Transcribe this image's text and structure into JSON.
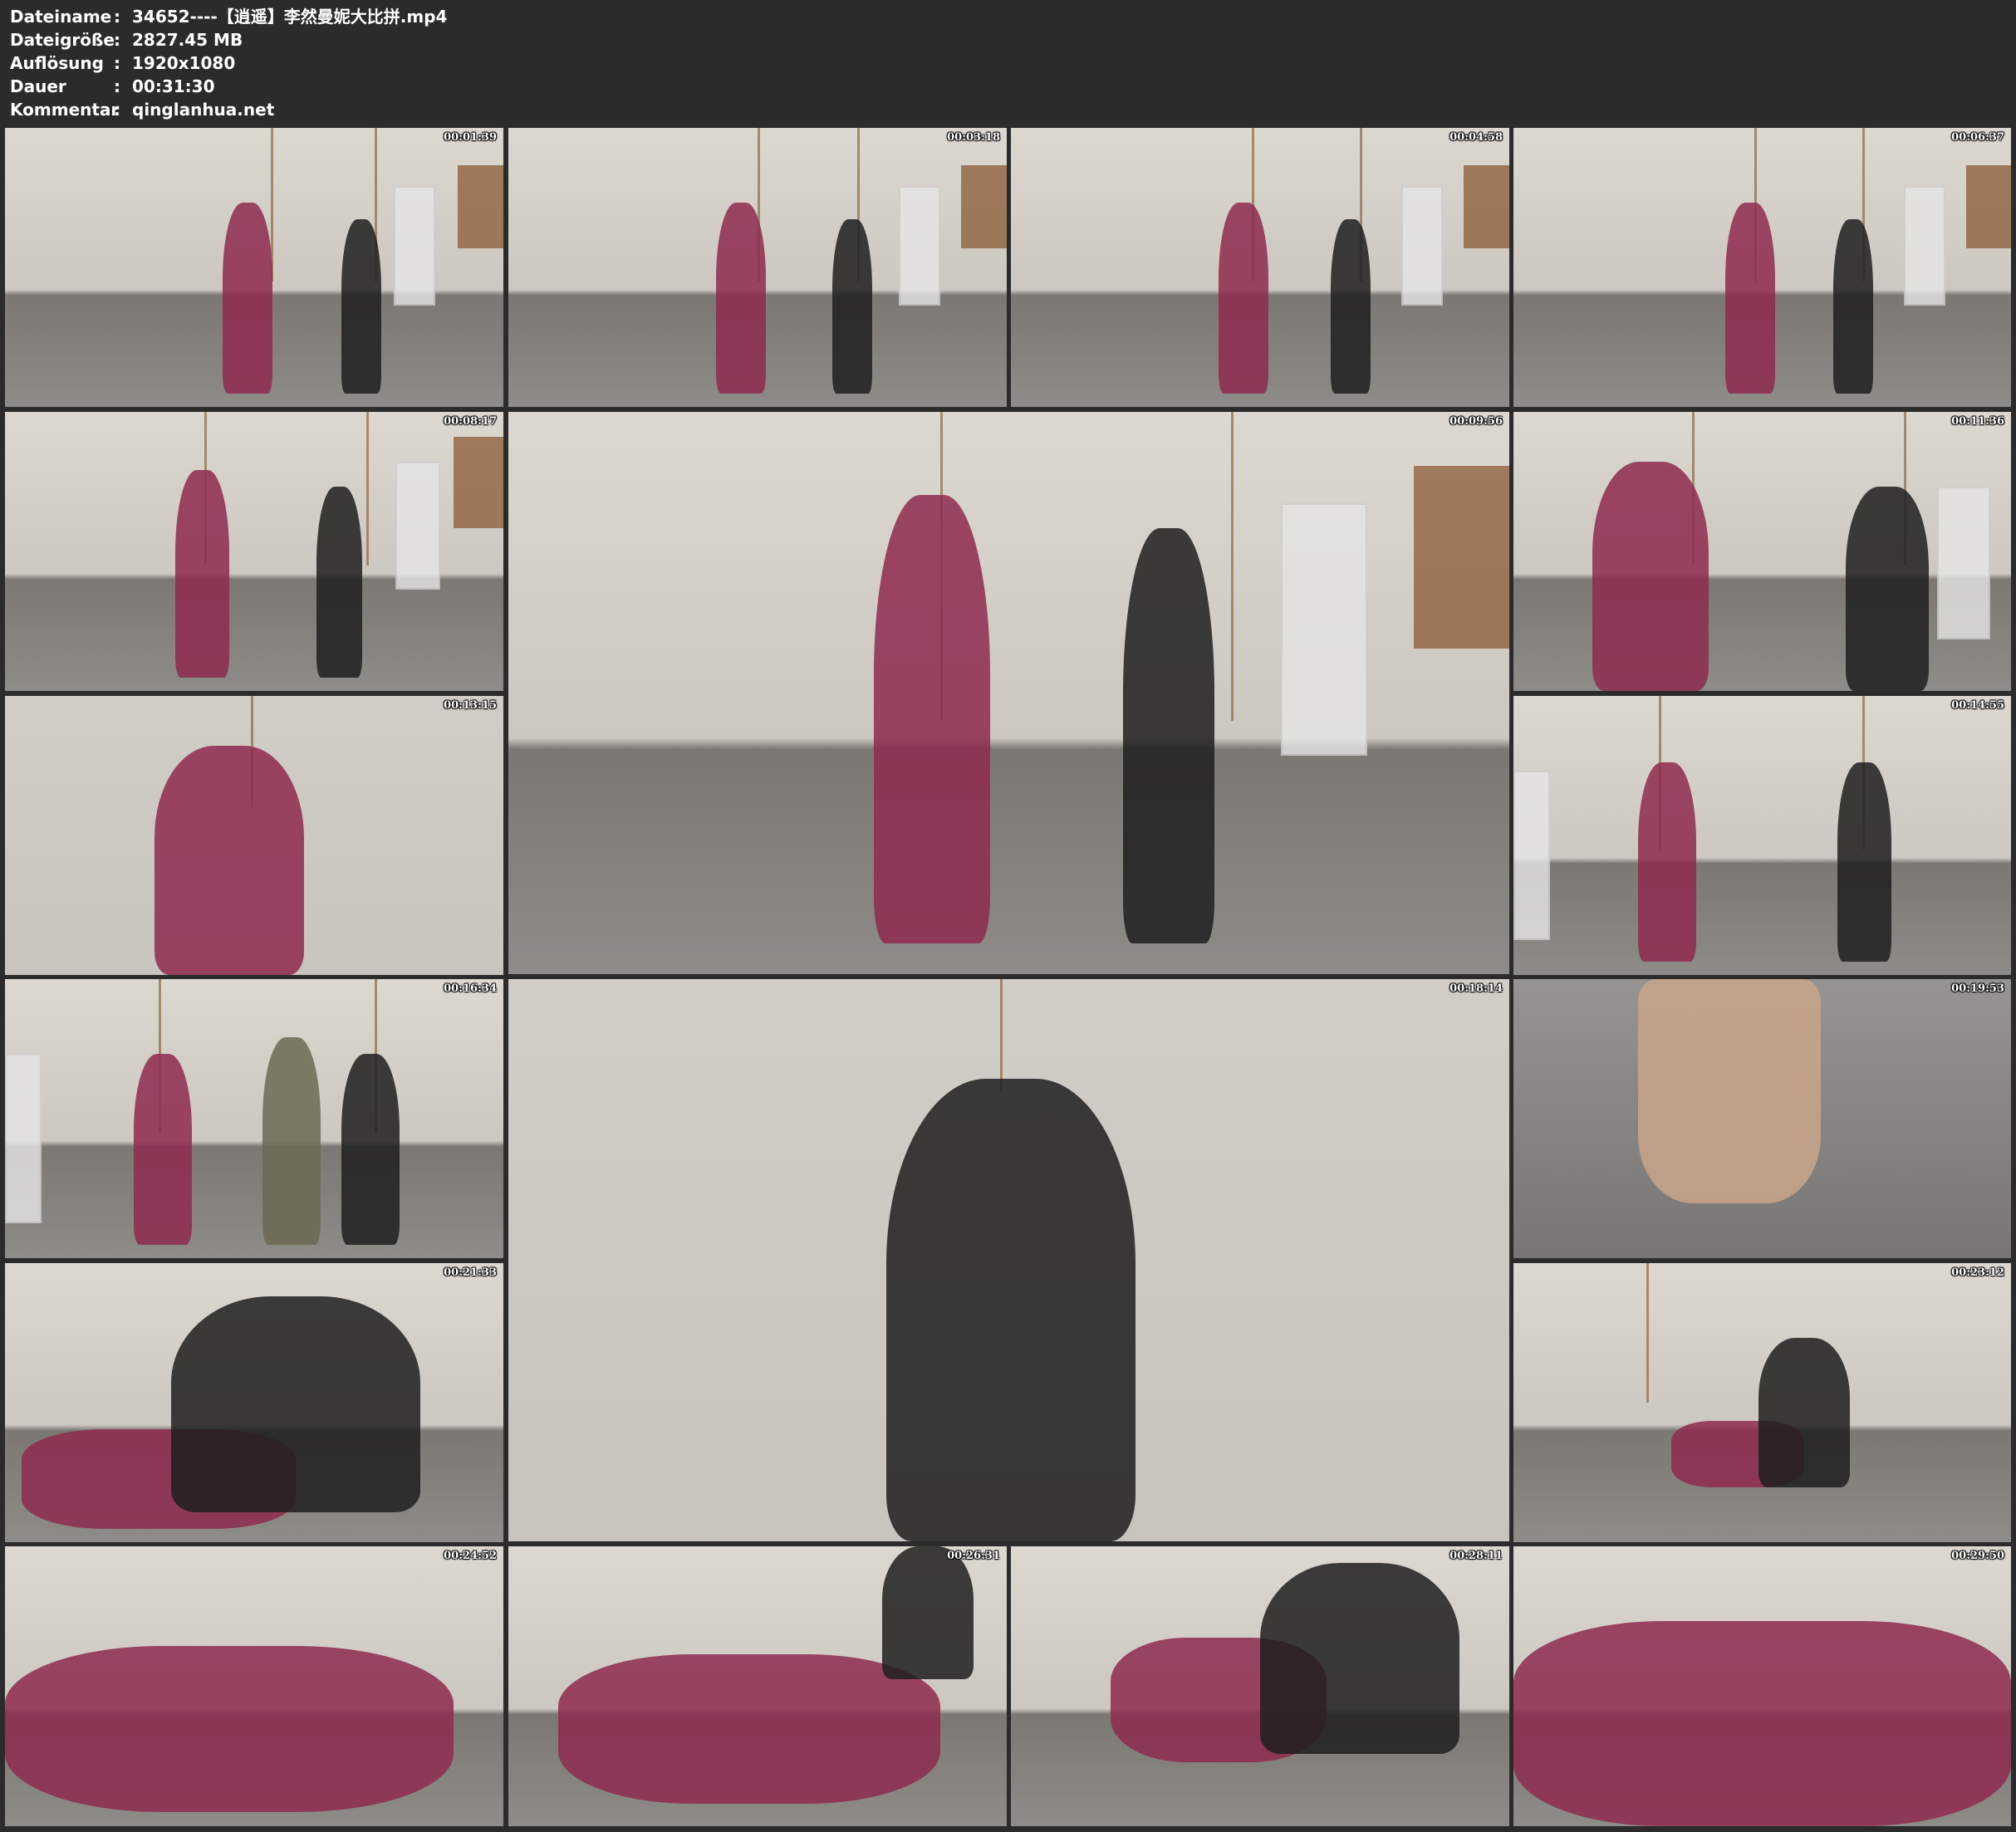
{
  "header": {
    "rows": [
      {
        "key": "Dateiname",
        "value": "34652----【逍遥】李然曼妮大比拼.mp4"
      },
      {
        "key": "Dateigröße",
        "value": "2827.45 MB"
      },
      {
        "key": "Auflösung",
        "value": "1920x1080"
      },
      {
        "key": "Dauer",
        "value": "00:31:30"
      },
      {
        "key": "Kommentar",
        "value": "qinglanhua.net"
      }
    ],
    "separator": ":"
  },
  "thumbnails": [
    {
      "timestamp": "00:01:39"
    },
    {
      "timestamp": "00:03:18"
    },
    {
      "timestamp": "00:04:58"
    },
    {
      "timestamp": "00:06:37"
    },
    {
      "timestamp": "00:08:17"
    },
    {
      "timestamp": "00:09:56"
    },
    {
      "timestamp": "00:11:36"
    },
    {
      "timestamp": "00:13:15"
    },
    {
      "timestamp": "00:14:55"
    },
    {
      "timestamp": "00:16:34"
    },
    {
      "timestamp": "00:18:14"
    },
    {
      "timestamp": "00:19:53"
    },
    {
      "timestamp": "00:21:33"
    },
    {
      "timestamp": "00:23:12"
    },
    {
      "timestamp": "00:24:52"
    },
    {
      "timestamp": "00:26:31"
    },
    {
      "timestamp": "00:28:11"
    },
    {
      "timestamp": "00:29:50"
    }
  ]
}
